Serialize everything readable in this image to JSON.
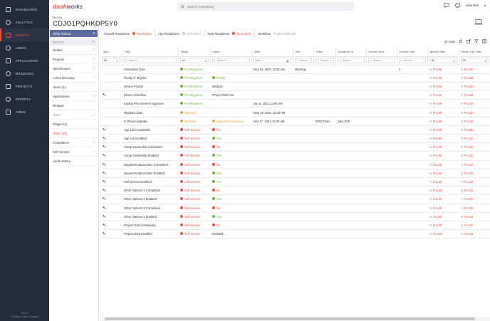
{
  "app": {
    "logo_a": "dash",
    "logo_b": "works",
    "search_placeholder": "Search everything",
    "user_name": "Julia Bell"
  },
  "nav": {
    "items": [
      {
        "label": "DASHBOARDS",
        "icon": "dashboard-icon"
      },
      {
        "label": "ANALYTICS",
        "icon": "analytics-icon"
      },
      {
        "label": "DEVICES",
        "icon": "devices-icon",
        "active": true
      },
      {
        "label": "USERS",
        "icon": "users-icon"
      },
      {
        "label": "APPLICATIONS",
        "icon": "applications-icon"
      },
      {
        "label": "MAILBOXES",
        "icon": "mailboxes-icon"
      },
      {
        "label": "PROJECTS",
        "icon": "projects-icon"
      },
      {
        "label": "REPORTS",
        "icon": "reports-icon"
      },
      {
        "label": "ADMIN",
        "icon": "admin-icon"
      }
    ],
    "version": "v5.5.0",
    "footer": "© Juriba | Help | Support"
  },
  "header": {
    "device_label": "Device",
    "device_name": "CDJO1PQHKDP5Y0"
  },
  "panel": {
    "rollout": "(Win) Rollout",
    "device_section": "DEVICE",
    "items": [
      "Details",
      "Projects",
      "Specification",
      "Active Directory",
      "Users (1)",
      "Applications",
      "Related"
    ],
    "tasks_section": "Tasks",
    "tasks_sub": [
      "Stages (2)",
      "Tasks (20)"
    ],
    "more": [
      "Compliance",
      "Self Service",
      "Audit History"
    ]
  },
  "readiness": {
    "overall": {
      "label": "Overall Readiness",
      "status": "BLOCKED"
    },
    "app": {
      "label": "App Readiness",
      "status": "IGNORED"
    },
    "task": {
      "label": "Task Readiness",
      "status": "BLOCKED"
    },
    "workflow": {
      "label": "Workflow",
      "status": "Project Path Set"
    }
  },
  "toolbar": {
    "rows": "20 rows"
  },
  "grid": {
    "columns": [
      "Type",
      "Task",
      "Stage",
      "Value",
      "Date",
      "Slot",
      "Team",
      "Assigned To",
      "Emails Sent",
      "Emails Total",
      "Bucket Task",
      "Read Only Task"
    ],
    "filters": {
      "type": "All",
      "task": "Search",
      "stage": "All",
      "value": "Search",
      "date": "Date",
      "slot": "Search",
      "team": "Search",
      "assigned": "Search",
      "emails_sent": "Search",
      "emails_total": "Search",
      "bucket": "All",
      "readonly": "All"
    },
    "rows": [
      {
        "icon": false,
        "task": "Scheduled Date",
        "stage": "Pre-Migration",
        "stage_type": "pre",
        "value": "",
        "value_type": "",
        "date": "Nov 12, 2020 12:00 AM",
        "slot": "Morning",
        "team": "",
        "assigned": "",
        "emails_sent": "",
        "emails_total": "1",
        "bucket": "FALSE",
        "readonly": "FALSE"
      },
      {
        "icon": false,
        "task": "Ready to Migrate",
        "stage": "Pre-Migration",
        "stage_type": "pre",
        "value": "Ready",
        "value_type": "ok",
        "date": "",
        "slot": "",
        "team": "",
        "assigned": "",
        "emails_sent": "",
        "emails_total": "",
        "bucket": "FALSE",
        "readonly": "FALSE"
      },
      {
        "icon": false,
        "task": "Device Priority",
        "stage": "Pre-Migration",
        "stage_type": "pre",
        "value": "Medium",
        "value_type": "",
        "date": "",
        "slot": "",
        "team": "",
        "assigned": "",
        "emails_sent": "",
        "emails_total": "",
        "bucket": "FALSE",
        "readonly": "FALSE"
      },
      {
        "icon": true,
        "task": "Device Workflow",
        "stage": "Pre-Migration",
        "stage_type": "pre",
        "value": "Project Path Set",
        "value_type": "",
        "date": "",
        "slot": "",
        "team": "",
        "assigned": "",
        "emails_sent": "",
        "emails_total": "",
        "bucket": "FALSE",
        "readonly": "FALSE"
      },
      {
        "icon": false,
        "task": "Laptop Procurement Approval",
        "stage": "Pre-Migration",
        "stage_type": "pre",
        "value": "",
        "value_type": "",
        "date": "Jan 5, 2021 12:00 AM",
        "slot": "",
        "team": "",
        "assigned": "",
        "emails_sent": "",
        "emails_total": "",
        "bucket": "FALSE",
        "readonly": "FALSE"
      },
      {
        "icon": false,
        "task": "Migrated Date",
        "stage": "Migration",
        "stage_type": "mig",
        "value": "",
        "value_type": "",
        "date": "May 14, 2021 12:00 AM",
        "slot": "",
        "team": "",
        "assigned": "",
        "emails_sent": "",
        "emails_total": "",
        "bucket": "FALSE",
        "readonly": "FALSE"
      },
      {
        "icon": false,
        "task": "In Place Upgrade",
        "stage": "Migration",
        "stage_type": "mig",
        "value": "Upgrade Postponed",
        "value_type": "up",
        "date": "Mar 17, 2021 12:00 AM",
        "slot": "",
        "team": "2004 Team",
        "assigned": "Julia Bell",
        "emails_sent": "",
        "emails_total": "",
        "bucket": "FALSE",
        "readonly": "FALSE"
      },
      {
        "icon": true,
        "task": "App List Completed",
        "stage": "Self Service",
        "stage_type": "ss",
        "value": "No",
        "value_type": "no",
        "date": "",
        "slot": "",
        "team": "",
        "assigned": "",
        "emails_sent": "",
        "emails_total": "",
        "bucket": "FALSE",
        "readonly": "FALSE"
      },
      {
        "icon": true,
        "task": "App List Enabled",
        "stage": "Self Service",
        "stage_type": "ss",
        "value": "Yes",
        "value_type": "ok",
        "date": "",
        "slot": "",
        "team": "",
        "assigned": "",
        "emails_sent": "",
        "emails_total": "",
        "bucket": "FALSE",
        "readonly": "FALSE"
      },
      {
        "icon": true,
        "task": "Comp Ownership Completed",
        "stage": "Self Service",
        "stage_type": "ss",
        "value": "No",
        "value_type": "no",
        "date": "",
        "slot": "",
        "team": "",
        "assigned": "",
        "emails_sent": "",
        "emails_total": "",
        "bucket": "FALSE",
        "readonly": "FALSE"
      },
      {
        "icon": true,
        "task": "Comp Ownership Enabled",
        "stage": "Self Service",
        "stage_type": "ss",
        "value": "Yes",
        "value_type": "ok",
        "date": "",
        "slot": "",
        "team": "",
        "assigned": "",
        "emails_sent": "",
        "emails_total": "",
        "bucket": "FALSE",
        "readonly": "FALSE"
      },
      {
        "icon": true,
        "task": "Department&Location Completed",
        "stage": "Self Service",
        "stage_type": "ss",
        "value": "No",
        "value_type": "no",
        "date": "",
        "slot": "",
        "team": "",
        "assigned": "",
        "emails_sent": "",
        "emails_total": "",
        "bucket": "FALSE",
        "readonly": "FALSE"
      },
      {
        "icon": true,
        "task": "Department&Location Enabled",
        "stage": "Self Service",
        "stage_type": "ss",
        "value": "Yes",
        "value_type": "ok",
        "date": "",
        "slot": "",
        "team": "",
        "assigned": "",
        "emails_sent": "",
        "emails_total": "",
        "bucket": "FALSE",
        "readonly": "FALSE"
      },
      {
        "icon": true,
        "task": "Self Service Enabled",
        "stage": "Self Service",
        "stage_type": "ss",
        "value": "Yes",
        "value_type": "ok",
        "date": "",
        "slot": "",
        "team": "",
        "assigned": "",
        "emails_sent": "",
        "emails_total": "",
        "bucket": "FALSE",
        "readonly": "FALSE"
      },
      {
        "icon": true,
        "task": "Other Options 1 Completed",
        "stage": "Self Service",
        "stage_type": "ss",
        "value": "No",
        "value_type": "no",
        "date": "",
        "slot": "",
        "team": "",
        "assigned": "",
        "emails_sent": "",
        "emails_total": "",
        "bucket": "FALSE",
        "readonly": "FALSE"
      },
      {
        "icon": true,
        "task": "Other Options 1 Enabled",
        "stage": "Self Service",
        "stage_type": "ss",
        "value": "Yes",
        "value_type": "ok",
        "date": "",
        "slot": "",
        "team": "",
        "assigned": "",
        "emails_sent": "",
        "emails_total": "",
        "bucket": "FALSE",
        "readonly": "FALSE"
      },
      {
        "icon": true,
        "task": "Other Options 2 Completed",
        "stage": "Self Service",
        "stage_type": "ss",
        "value": "No",
        "value_type": "no",
        "date": "",
        "slot": "",
        "team": "",
        "assigned": "",
        "emails_sent": "",
        "emails_total": "",
        "bucket": "FALSE",
        "readonly": "FALSE"
      },
      {
        "icon": true,
        "task": "Other Options 2 Enabled",
        "stage": "Self Service",
        "stage_type": "ss",
        "value": "Yes",
        "value_type": "ok",
        "date": "",
        "slot": "",
        "team": "",
        "assigned": "",
        "emails_sent": "",
        "emails_total": "",
        "bucket": "FALSE",
        "readonly": "FALSE"
      },
      {
        "icon": true,
        "task": "Project Date Completed",
        "stage": "Self Service",
        "stage_type": "ss",
        "value": "No",
        "value_type": "no",
        "date": "",
        "slot": "",
        "team": "",
        "assigned": "",
        "emails_sent": "",
        "emails_total": "",
        "bucket": "FALSE",
        "readonly": "FALSE"
      },
      {
        "icon": true,
        "task": "Project Date Enabled",
        "stage": "Self Service",
        "stage_type": "ss",
        "value": "Enabled",
        "value_type": "",
        "date": "",
        "slot": "",
        "team": "",
        "assigned": "",
        "emails_sent": "",
        "emails_total": "",
        "bucket": "FALSE",
        "readonly": "FALSE"
      }
    ]
  },
  "colors": {
    "accent": "#e8503a",
    "nav_bg": "#232b3d",
    "pre": "#6cb33f",
    "migration": "#e8a23a",
    "rollout": "#5b6c9d"
  }
}
